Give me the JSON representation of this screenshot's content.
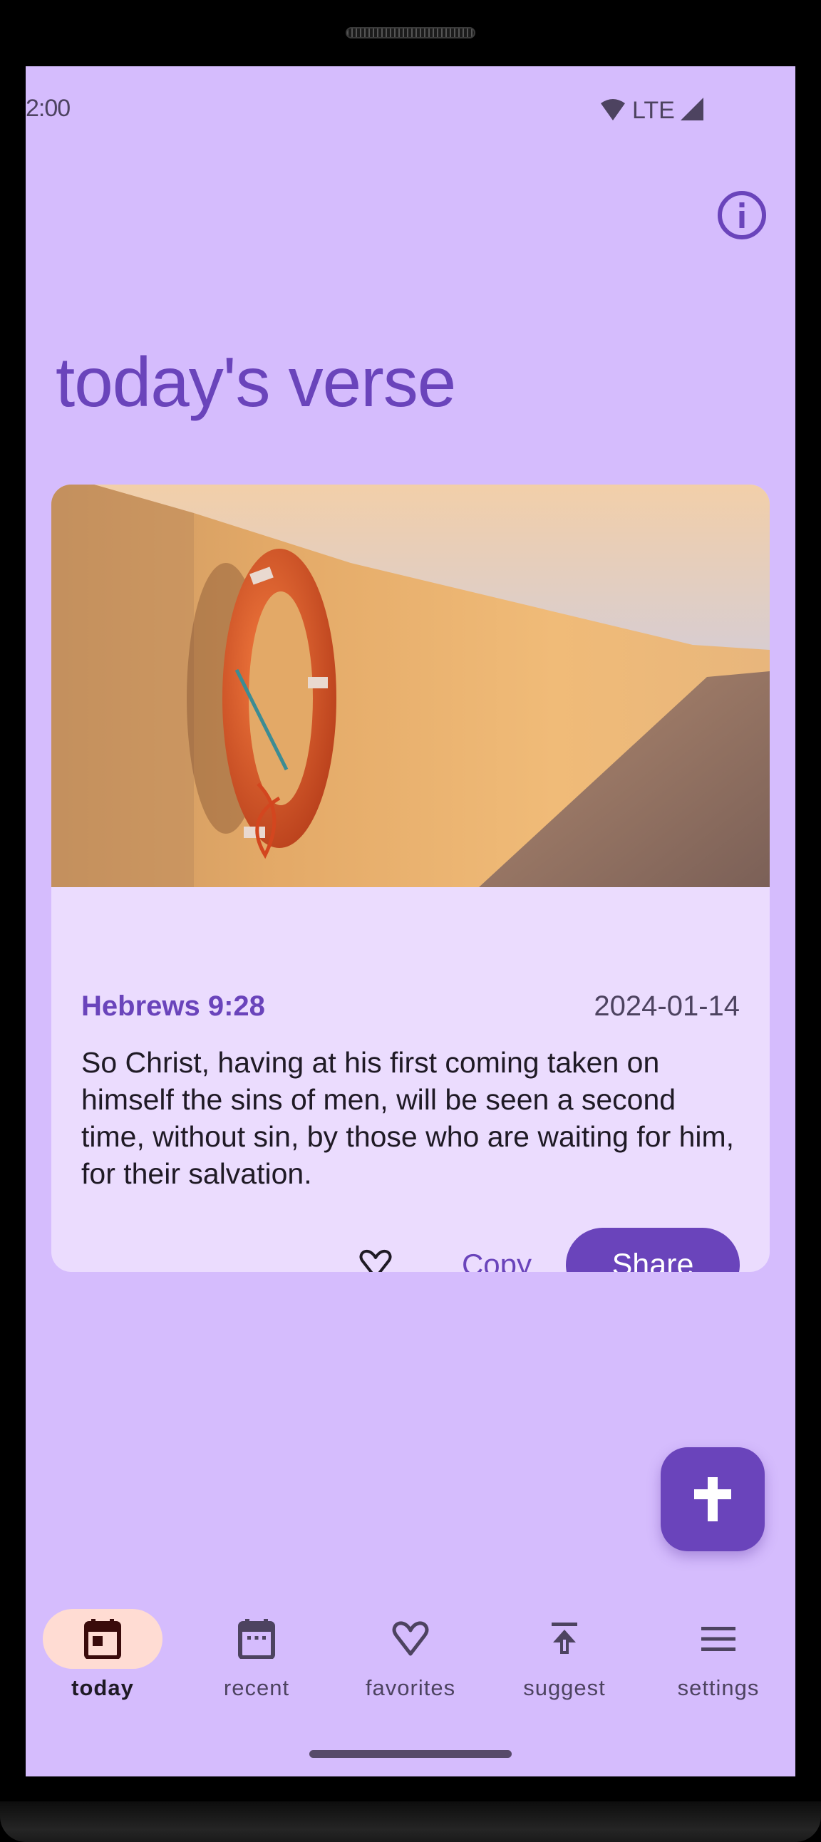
{
  "status_bar": {
    "time": "2:00",
    "network_label": "LTE",
    "icons": [
      "wifi-icon",
      "cell-signal-icon"
    ]
  },
  "header": {
    "info_icon": "info-icon",
    "title": "today's verse"
  },
  "verse_card": {
    "image_description": "orange life buoy hanging on a sunlit stone wall by the sea",
    "reference": "Hebrews 9:28",
    "date": "2024-01-14",
    "text": "So Christ, having at his first coming taken on himself the sins of men, will be seen a second time, without sin, by those who are waiting for him, for their salvation.",
    "favorite_icon": "heart-outline-icon",
    "copy_label": "Copy",
    "share_label": "Share"
  },
  "fab": {
    "icon": "cross-icon"
  },
  "bottom_nav": {
    "active_index": 0,
    "items": [
      {
        "label": "today",
        "icon": "calendar-today-icon"
      },
      {
        "label": "recent",
        "icon": "calendar-recent-icon"
      },
      {
        "label": "favorites",
        "icon": "heart-outline-icon"
      },
      {
        "label": "suggest",
        "icon": "upload-icon"
      },
      {
        "label": "settings",
        "icon": "menu-icon"
      }
    ]
  },
  "colors": {
    "background": "#d5bcfd",
    "card": "#ebdcfe",
    "primary": "#6a44bb",
    "nav_active_pill": "#ffdcd3",
    "on_surface": "#1f1a25",
    "on_surface_variant": "#4d4360"
  }
}
